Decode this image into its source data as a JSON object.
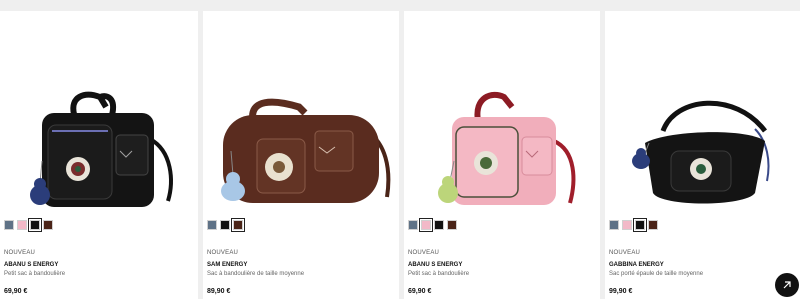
{
  "products": [
    {
      "badge": "NOUVEAU",
      "name": "ABANU S ENERGY",
      "description": "Petit sac à bandoulière",
      "price": "69,90 €",
      "image_alt": "Black crossbody bag with monkey charm",
      "bag_color": "#121212",
      "swatches": [
        "#5f7286",
        "#f2b9c8",
        "#111111",
        "#4a2418"
      ],
      "selected_swatch": 2
    },
    {
      "badge": "NOUVEAU",
      "name": "SAM ENERGY",
      "description": "Sac à bandoulière de taille moyenne",
      "price": "89,90 €",
      "image_alt": "Brown barrel crossbody bag with monkey charm",
      "bag_color": "#5a2c1f",
      "swatches": [
        "#5f7286",
        "#111111",
        "#4a2418"
      ],
      "selected_swatch": 2
    },
    {
      "badge": "NOUVEAU",
      "name": "ABANU S ENERGY",
      "description": "Petit sac à bandoulière",
      "price": "69,90 €",
      "image_alt": "Pink crossbody bag with red strap and monkey charm",
      "bag_color": "#f1aebb",
      "swatches": [
        "#5f7286",
        "#f2b9c8",
        "#111111",
        "#4a2418"
      ],
      "selected_swatch": 1
    },
    {
      "badge": "NOUVEAU",
      "name": "GABBINA ENERGY",
      "description": "Sac porté épaule de taille moyenne",
      "price": "99,90 €",
      "image_alt": "Black medium shoulder bag with monkey charm",
      "bag_color": "#121212",
      "swatches": [
        "#5f7286",
        "#f2b9c8",
        "#111111",
        "#4a2418"
      ],
      "selected_swatch": 2
    }
  ],
  "fab": {
    "icon": "share-arrow-icon"
  }
}
